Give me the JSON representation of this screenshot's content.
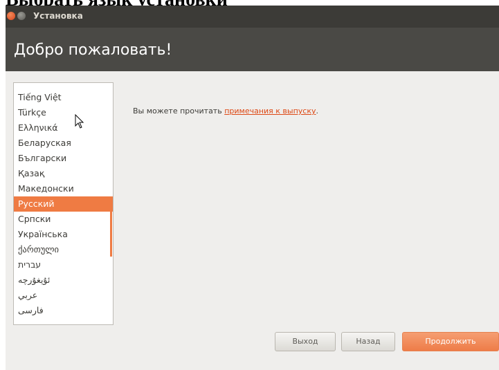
{
  "document_heading": "Выбрать язык установки",
  "window": {
    "title": "Установка",
    "heading": "Добро пожаловать!"
  },
  "language_list": {
    "items": [
      {
        "label": "Tiếng Việt",
        "selected": false
      },
      {
        "label": "Türkçe",
        "selected": false
      },
      {
        "label": "Ελληνικά",
        "selected": false
      },
      {
        "label": "Беларуская",
        "selected": false
      },
      {
        "label": "Български",
        "selected": false
      },
      {
        "label": "Қазақ",
        "selected": false
      },
      {
        "label": "Македонски",
        "selected": false
      },
      {
        "label": "Русский",
        "selected": true
      },
      {
        "label": "Српски",
        "selected": false
      },
      {
        "label": "Українська",
        "selected": false
      },
      {
        "label": "ქართული",
        "selected": false
      },
      {
        "label": "עברית",
        "selected": false
      },
      {
        "label": "ئۇيغۇرچە",
        "selected": false
      },
      {
        "label": "عربي",
        "selected": false
      },
      {
        "label": "فارسی",
        "selected": false
      }
    ]
  },
  "notice": {
    "text": "Вы можете прочитать ",
    "link": "примечания к выпуску",
    "suffix": "."
  },
  "buttons": {
    "quit": "Выход",
    "back": "Назад",
    "continue": "Продолжить"
  },
  "colors": {
    "accent": "#ef7b43",
    "titlebar": "#3c3b37",
    "header": "#4a4945"
  }
}
